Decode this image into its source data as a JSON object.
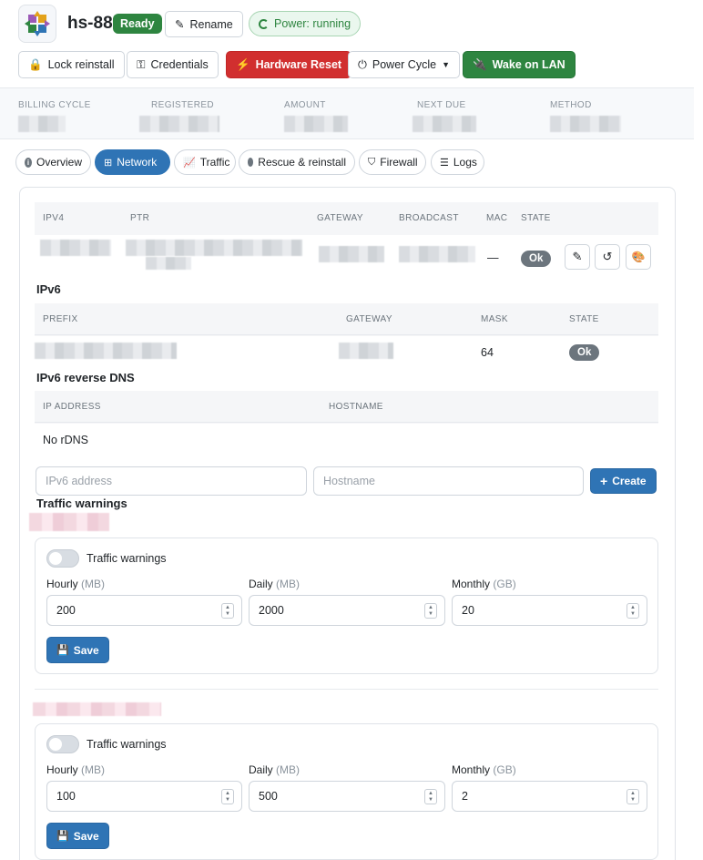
{
  "header": {
    "host_name": "hs-88",
    "status_badge": "Ready",
    "rename_label": "Rename",
    "power_status": "Power: running",
    "lock_reinstall_label": "Lock reinstall",
    "credentials_label": "Credentials",
    "hardware_reset_label": "Hardware Reset",
    "power_cycle_label": "Power Cycle",
    "wake_on_lan_label": "Wake on LAN"
  },
  "summary": {
    "billing_cycle_label": "BILLING CYCLE",
    "registered_label": "REGISTERED",
    "amount_label": "AMOUNT",
    "next_due_label": "NEXT DUE",
    "method_label": "METHOD"
  },
  "tabs": [
    {
      "label": "Overview",
      "icon": "info-icon",
      "active": false
    },
    {
      "label": "Network",
      "icon": "network-icon",
      "active": true
    },
    {
      "label": "Traffic",
      "icon": "chart-icon",
      "active": false
    },
    {
      "label": "Rescue & reinstall",
      "icon": "disc-icon",
      "active": false
    },
    {
      "label": "Firewall",
      "icon": "shield-icon",
      "active": false
    },
    {
      "label": "Logs",
      "icon": "list-icon",
      "active": false
    }
  ],
  "ipv4": {
    "headers": {
      "ipv4": "IPV4",
      "ptr": "PTR",
      "gateway": "GATEWAY",
      "broadcast": "BROADCAST",
      "mac": "MAC",
      "state": "STATE"
    },
    "row": {
      "mac": "—",
      "state": "Ok"
    }
  },
  "ipv6": {
    "title": "IPv6",
    "headers": {
      "prefix": "PREFIX",
      "gateway": "GATEWAY",
      "mask": "MASK",
      "state": "STATE"
    },
    "row": {
      "mask": "64",
      "state": "Ok"
    }
  },
  "rdns": {
    "title": "IPv6 reverse DNS",
    "headers": {
      "ip_address": "IP ADDRESS",
      "hostname": "HOSTNAME"
    },
    "empty_text": "No rDNS",
    "address_placeholder": "IPv6 address",
    "hostname_placeholder": "Hostname",
    "create_label": "Create"
  },
  "traffic_warnings": {
    "title": "Traffic warnings",
    "blocks": [
      {
        "toggle_label": "Traffic warnings",
        "enabled": false,
        "hourly_label": "Hourly",
        "hourly_unit": "(MB)",
        "hourly_value": "200",
        "daily_label": "Daily",
        "daily_unit": "(MB)",
        "daily_value": "2000",
        "monthly_label": "Monthly",
        "monthly_unit": "(GB)",
        "monthly_value": "20",
        "save_label": "Save"
      },
      {
        "toggle_label": "Traffic warnings",
        "enabled": false,
        "hourly_label": "Hourly",
        "hourly_unit": "(MB)",
        "hourly_value": "100",
        "daily_label": "Daily",
        "daily_unit": "(MB)",
        "daily_value": "500",
        "monthly_label": "Monthly",
        "monthly_unit": "(GB)",
        "monthly_value": "2",
        "save_label": "Save"
      }
    ]
  },
  "colors": {
    "primary": "#2f74b5",
    "success": "#2e8540",
    "danger": "#d12f2f",
    "muted_pill": "#6c757d"
  }
}
